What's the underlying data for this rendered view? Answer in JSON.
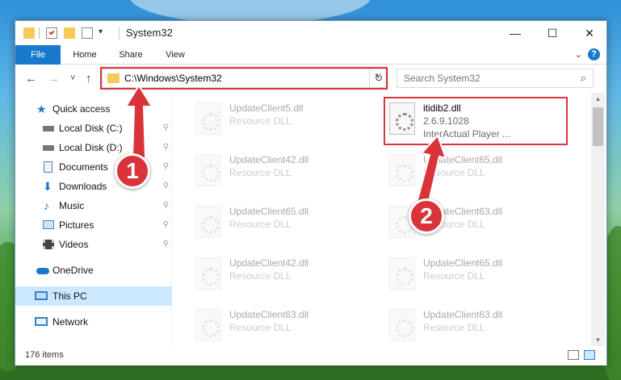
{
  "window": {
    "title": "System32",
    "controls": {
      "minimize": "—",
      "maximize": "☐",
      "close": "✕"
    }
  },
  "ribbon": {
    "tabs": [
      "File",
      "Home",
      "Share",
      "View"
    ],
    "help": "?"
  },
  "nav": {
    "back": "←",
    "forward": "→",
    "recent": "˅",
    "up": "↑",
    "address": "C:\\Windows\\System32",
    "dropdown": "˅",
    "refresh": "↻",
    "search_placeholder": "Search System32",
    "search_icon": "⌕"
  },
  "sidebar": {
    "items": [
      {
        "label": "Quick access",
        "icon": "star-icon",
        "pinned": false
      },
      {
        "label": "Local Disk (C:)",
        "icon": "drive-icon",
        "pinned": true
      },
      {
        "label": "Local Disk (D:)",
        "icon": "drive-icon",
        "pinned": true
      },
      {
        "label": "Documents",
        "icon": "documents-icon",
        "pinned": true
      },
      {
        "label": "Downloads",
        "icon": "downloads-icon",
        "pinned": true
      },
      {
        "label": "Music",
        "icon": "music-icon",
        "pinned": true
      },
      {
        "label": "Pictures",
        "icon": "pictures-icon",
        "pinned": true
      },
      {
        "label": "Videos",
        "icon": "videos-icon",
        "pinned": true
      },
      {
        "label": "OneDrive",
        "icon": "onedrive-icon",
        "pinned": false
      },
      {
        "label": "This PC",
        "icon": "pc-icon",
        "pinned": false,
        "selected": true
      },
      {
        "label": "Network",
        "icon": "network-icon",
        "pinned": false
      }
    ],
    "pin_glyph": "📌"
  },
  "files": {
    "left": [
      {
        "name": "UpdateClient5.dll",
        "type": "Resource DLL"
      },
      {
        "name": "UpdateClient42.dll",
        "type": "Resource DLL"
      },
      {
        "name": "UpdateClient65.dll",
        "type": "Resource DLL"
      },
      {
        "name": "UpdateClient42.dll",
        "type": "Resource DLL"
      },
      {
        "name": "UpdateClient63.dll",
        "type": "Resource DLL"
      }
    ],
    "right": [
      {
        "name": "itidib2.dll",
        "version": "2.6.9.1028",
        "description": "InterActual Player ...",
        "highlighted": true
      },
      {
        "name": "UpdateClient65.dll",
        "type": "Resource DLL"
      },
      {
        "name": "UpdateClient63.dll",
        "type": "Resource DLL"
      },
      {
        "name": "UpdateClient65.dll",
        "type": "Resource DLL"
      },
      {
        "name": "UpdateClient63.dll",
        "type": "Resource DLL"
      }
    ]
  },
  "status": {
    "count": "176 items"
  },
  "callouts": {
    "one": "1",
    "two": "2"
  },
  "colors": {
    "accent": "#1979ca",
    "highlight": "#d9343a",
    "selected": "#cce8ff"
  }
}
